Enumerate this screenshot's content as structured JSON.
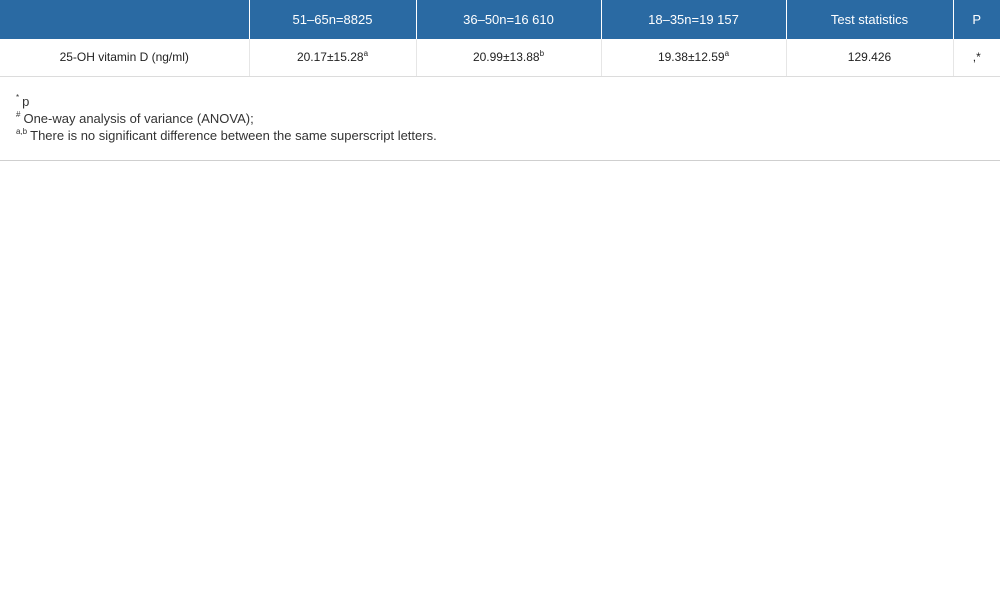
{
  "table": {
    "headers": [
      "",
      "51–65n=8825",
      "36–50n=16 610",
      "18–35n=19 157",
      "Test statistics",
      "P"
    ],
    "rows": [
      {
        "label": "25-OH vitamin D (ng/ml)",
        "cells": [
          {
            "value": "20.17±15.28",
            "sup": "a"
          },
          {
            "value": "20.99±13.88",
            "sup": "b"
          },
          {
            "value": "19.38±12.59",
            "sup": "a"
          },
          {
            "value": "129.426",
            "sup": ""
          },
          {
            "value": ",*",
            "sup": ""
          }
        ]
      }
    ]
  },
  "footnotes": [
    {
      "mark": "*",
      "text": "p"
    },
    {
      "mark": "#",
      "text": "One-way analysis of variance (ANOVA);"
    },
    {
      "mark": "a,b",
      "text": "There is no significant difference between the same superscript letters."
    }
  ]
}
